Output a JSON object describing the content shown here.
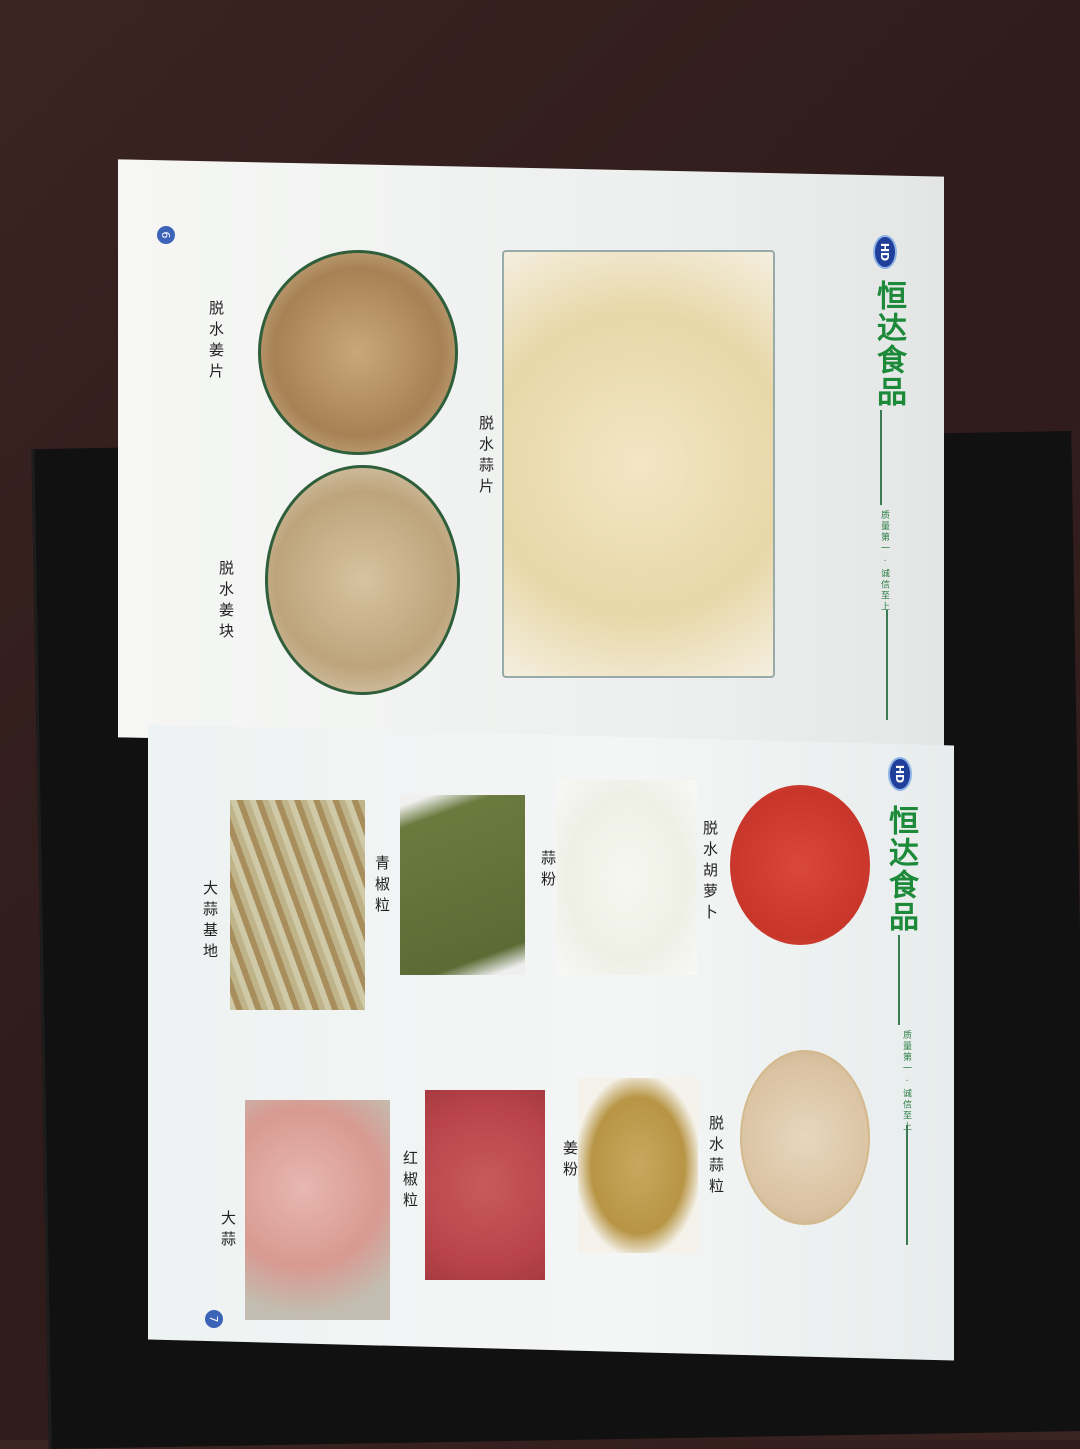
{
  "brand": "恒达食品",
  "logo_text": "HD",
  "slogan": "质量第一 · 诚信至上",
  "page_left": {
    "number": "6",
    "products": [
      {
        "label": "脱水蒜片"
      },
      {
        "label": "脱水姜片"
      },
      {
        "label": "脱水姜块"
      }
    ]
  },
  "page_right": {
    "number": "7",
    "products": [
      {
        "label": "脱水胡萝卜"
      },
      {
        "label": "脱水蒜粒"
      },
      {
        "label": "蒜粉"
      },
      {
        "label": "姜粉"
      },
      {
        "label": "青椒粒"
      },
      {
        "label": "红椒粒"
      },
      {
        "label": "大蒜基地"
      },
      {
        "label": "大蒜"
      }
    ]
  }
}
